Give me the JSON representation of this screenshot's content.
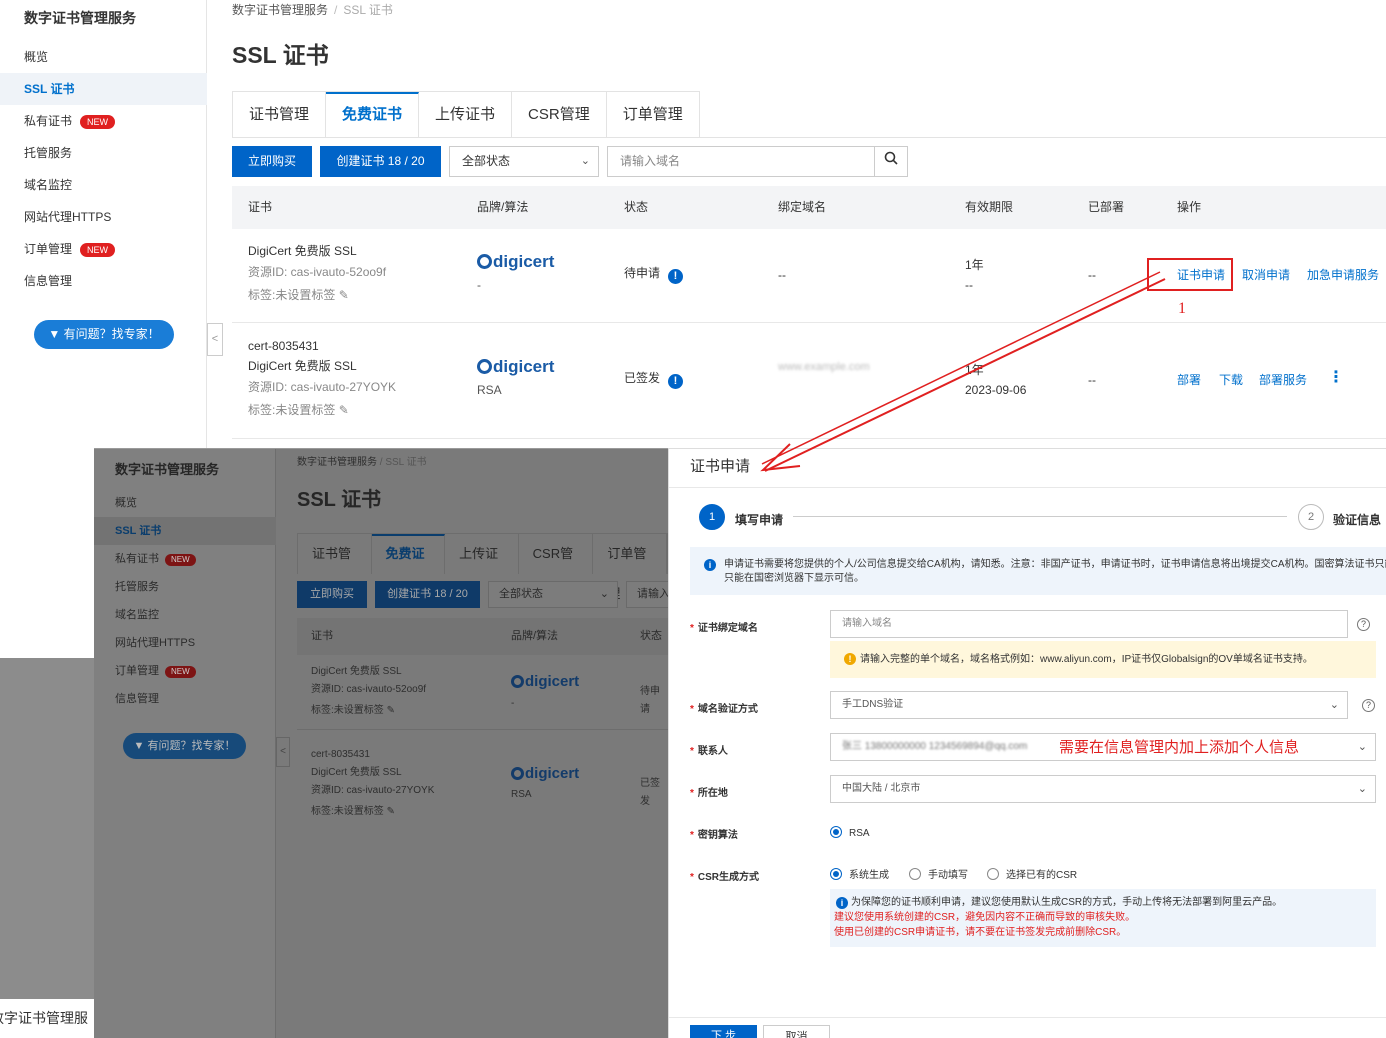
{
  "bg": {
    "brand": "数字证书管理服务",
    "nav": [
      {
        "label": "概览",
        "badge": ""
      },
      {
        "label": "SSL 证书",
        "badge": ""
      },
      {
        "label": "私有证书",
        "badge": "NEW"
      },
      {
        "label": "托管服务",
        "badge": ""
      },
      {
        "label": "域名监控",
        "badge": ""
      },
      {
        "label": "网站代理HTTPS",
        "badge": ""
      },
      {
        "label": "订单管理",
        "badge": "NEW"
      },
      {
        "label": "信息管理",
        "badge": ""
      }
    ],
    "help": "有问题？找专家！",
    "collapse": "<",
    "breadcrumb": [
      "数字证书管理服务",
      "/",
      "SSL 证书"
    ],
    "title": "SSL 证书",
    "tabs": [
      "证书管理",
      "免费证书",
      "上传证书",
      "CSR管理",
      "订单管理"
    ],
    "toolbar": {
      "buy": "立即购买",
      "create": "创建证书 18 / 20",
      "status_select": "全部状态",
      "search_placeholder": "请输入域名"
    },
    "columns": [
      "证书",
      "品牌/算法",
      "状态",
      "绑定域名",
      "有效期限",
      "已部署",
      "操作"
    ],
    "rows": [
      {
        "name": "",
        "product": "DigiCert 免费版 SSL",
        "resource": "资源ID: cas-ivauto-52oo9f",
        "tag": "标签:未设置标签",
        "brand": "digicert",
        "algo": "-",
        "status": "待申请",
        "domain": "--",
        "validity": "1年",
        "expiry": "--",
        "deployed": "--",
        "actions": [
          "证书申请",
          "取消申请",
          "加急申请服务"
        ]
      },
      {
        "name": "cert-8035431",
        "product": "DigiCert 免费版 SSL",
        "resource": "资源ID: cas-ivauto-27YOYK",
        "tag": "标签:未设置标签",
        "brand": "digicert",
        "algo": "RSA",
        "status": "已签发",
        "domain_blurred": "www.example.com",
        "validity": "1年",
        "expiry": "2023-09-06",
        "deployed": "--",
        "actions": [
          "部署",
          "下载",
          "部署服务"
        ]
      }
    ],
    "annotation_number": "1"
  },
  "overlay": {
    "brand": "数字证书管理服务",
    "nav": [
      {
        "label": "概览",
        "badge": ""
      },
      {
        "label": "SSL 证书",
        "badge": ""
      },
      {
        "label": "私有证书",
        "badge": "NEW"
      },
      {
        "label": "托管服务",
        "badge": ""
      },
      {
        "label": "域名监控",
        "badge": ""
      },
      {
        "label": "网站代理HTTPS",
        "badge": ""
      },
      {
        "label": "订单管理",
        "badge": "NEW"
      },
      {
        "label": "信息管理",
        "badge": ""
      }
    ],
    "help": "有问题？找专家！",
    "breadcrumb": [
      "数字证书管理服务",
      "/",
      "SSL 证书"
    ],
    "title": "SSL 证书",
    "tabs": [
      "证书管理",
      "免费证书",
      "上传证书",
      "CSR管理",
      "订单管理"
    ],
    "buy": "立即购买",
    "create": "创建证书 18 / 20",
    "status_select": "全部状态",
    "search_fragment": "请输入",
    "columns": [
      "证书",
      "品牌/算法",
      "状态"
    ],
    "row1": {
      "product": "DigiCert 免费版 SSL",
      "resource": "资源ID: cas-ivauto-52oo9f",
      "tag": "标签:未设置标签",
      "algo": "-",
      "status": "待申请"
    },
    "row2": {
      "name": "cert-8035431",
      "product": "DigiCert 免费版 SSL",
      "resource": "资源ID: cas-ivauto-27YOYK",
      "tag": "标签:未设置标签",
      "algo": "RSA",
      "status": "已签发"
    },
    "bottom_strip": "数字证书管理服"
  },
  "dialog": {
    "title": "证书申请",
    "steps": [
      {
        "num": "1",
        "label": "填写申请"
      },
      {
        "num": "2",
        "label": "验证信息"
      }
    ],
    "info": "申请证书需要将您提供的个人/公司信息提交给CA机构，请知悉。注意：非国产证书，申请证书时，证书申请信息将出境提交CA机构。国密算法证书只能在国密浏览器下显示可信。",
    "info_line2": "只能在国密浏览器下显示可信。",
    "fields": {
      "domain_label": "证书绑定域名",
      "domain_placeholder": "请输入域名",
      "domain_hint": "请输入完整的单个域名，域名格式例如：www.aliyun.com，IP证书仅Globalsign的OV单域名证书支持。",
      "verify_label": "域名验证方式",
      "verify_value": "手工DNS验证",
      "contact_label": "联系人",
      "contact_value_blurred": "张三 13800000000 1234569894@qq.com",
      "location_label": "所在地",
      "location_value": "中国大陆 / 北京市",
      "algo_label": "密钥算法",
      "algo_option": "RSA",
      "csr_label": "CSR生成方式",
      "csr_options": [
        "系统生成",
        "手动填写",
        "选择已有的CSR"
      ]
    },
    "csr_notice": {
      "line1": "为保障您的证书顺利申请，建议您使用默认生成CSR的方式，手动上传将无法部署到阿里云产品。",
      "line2": "建议您使用系统创建的CSR，避免因内容不正确而导致的审核失败。",
      "line3": "使用已创建的CSR申请证书，请不要在证书签发完成前删除CSR。"
    },
    "annotation": "需要在信息管理内加上添加个人信息",
    "next": "下 步",
    "cancel": "取消"
  },
  "colors": {
    "primary": "#0064c8",
    "annotation": "#e02020"
  }
}
